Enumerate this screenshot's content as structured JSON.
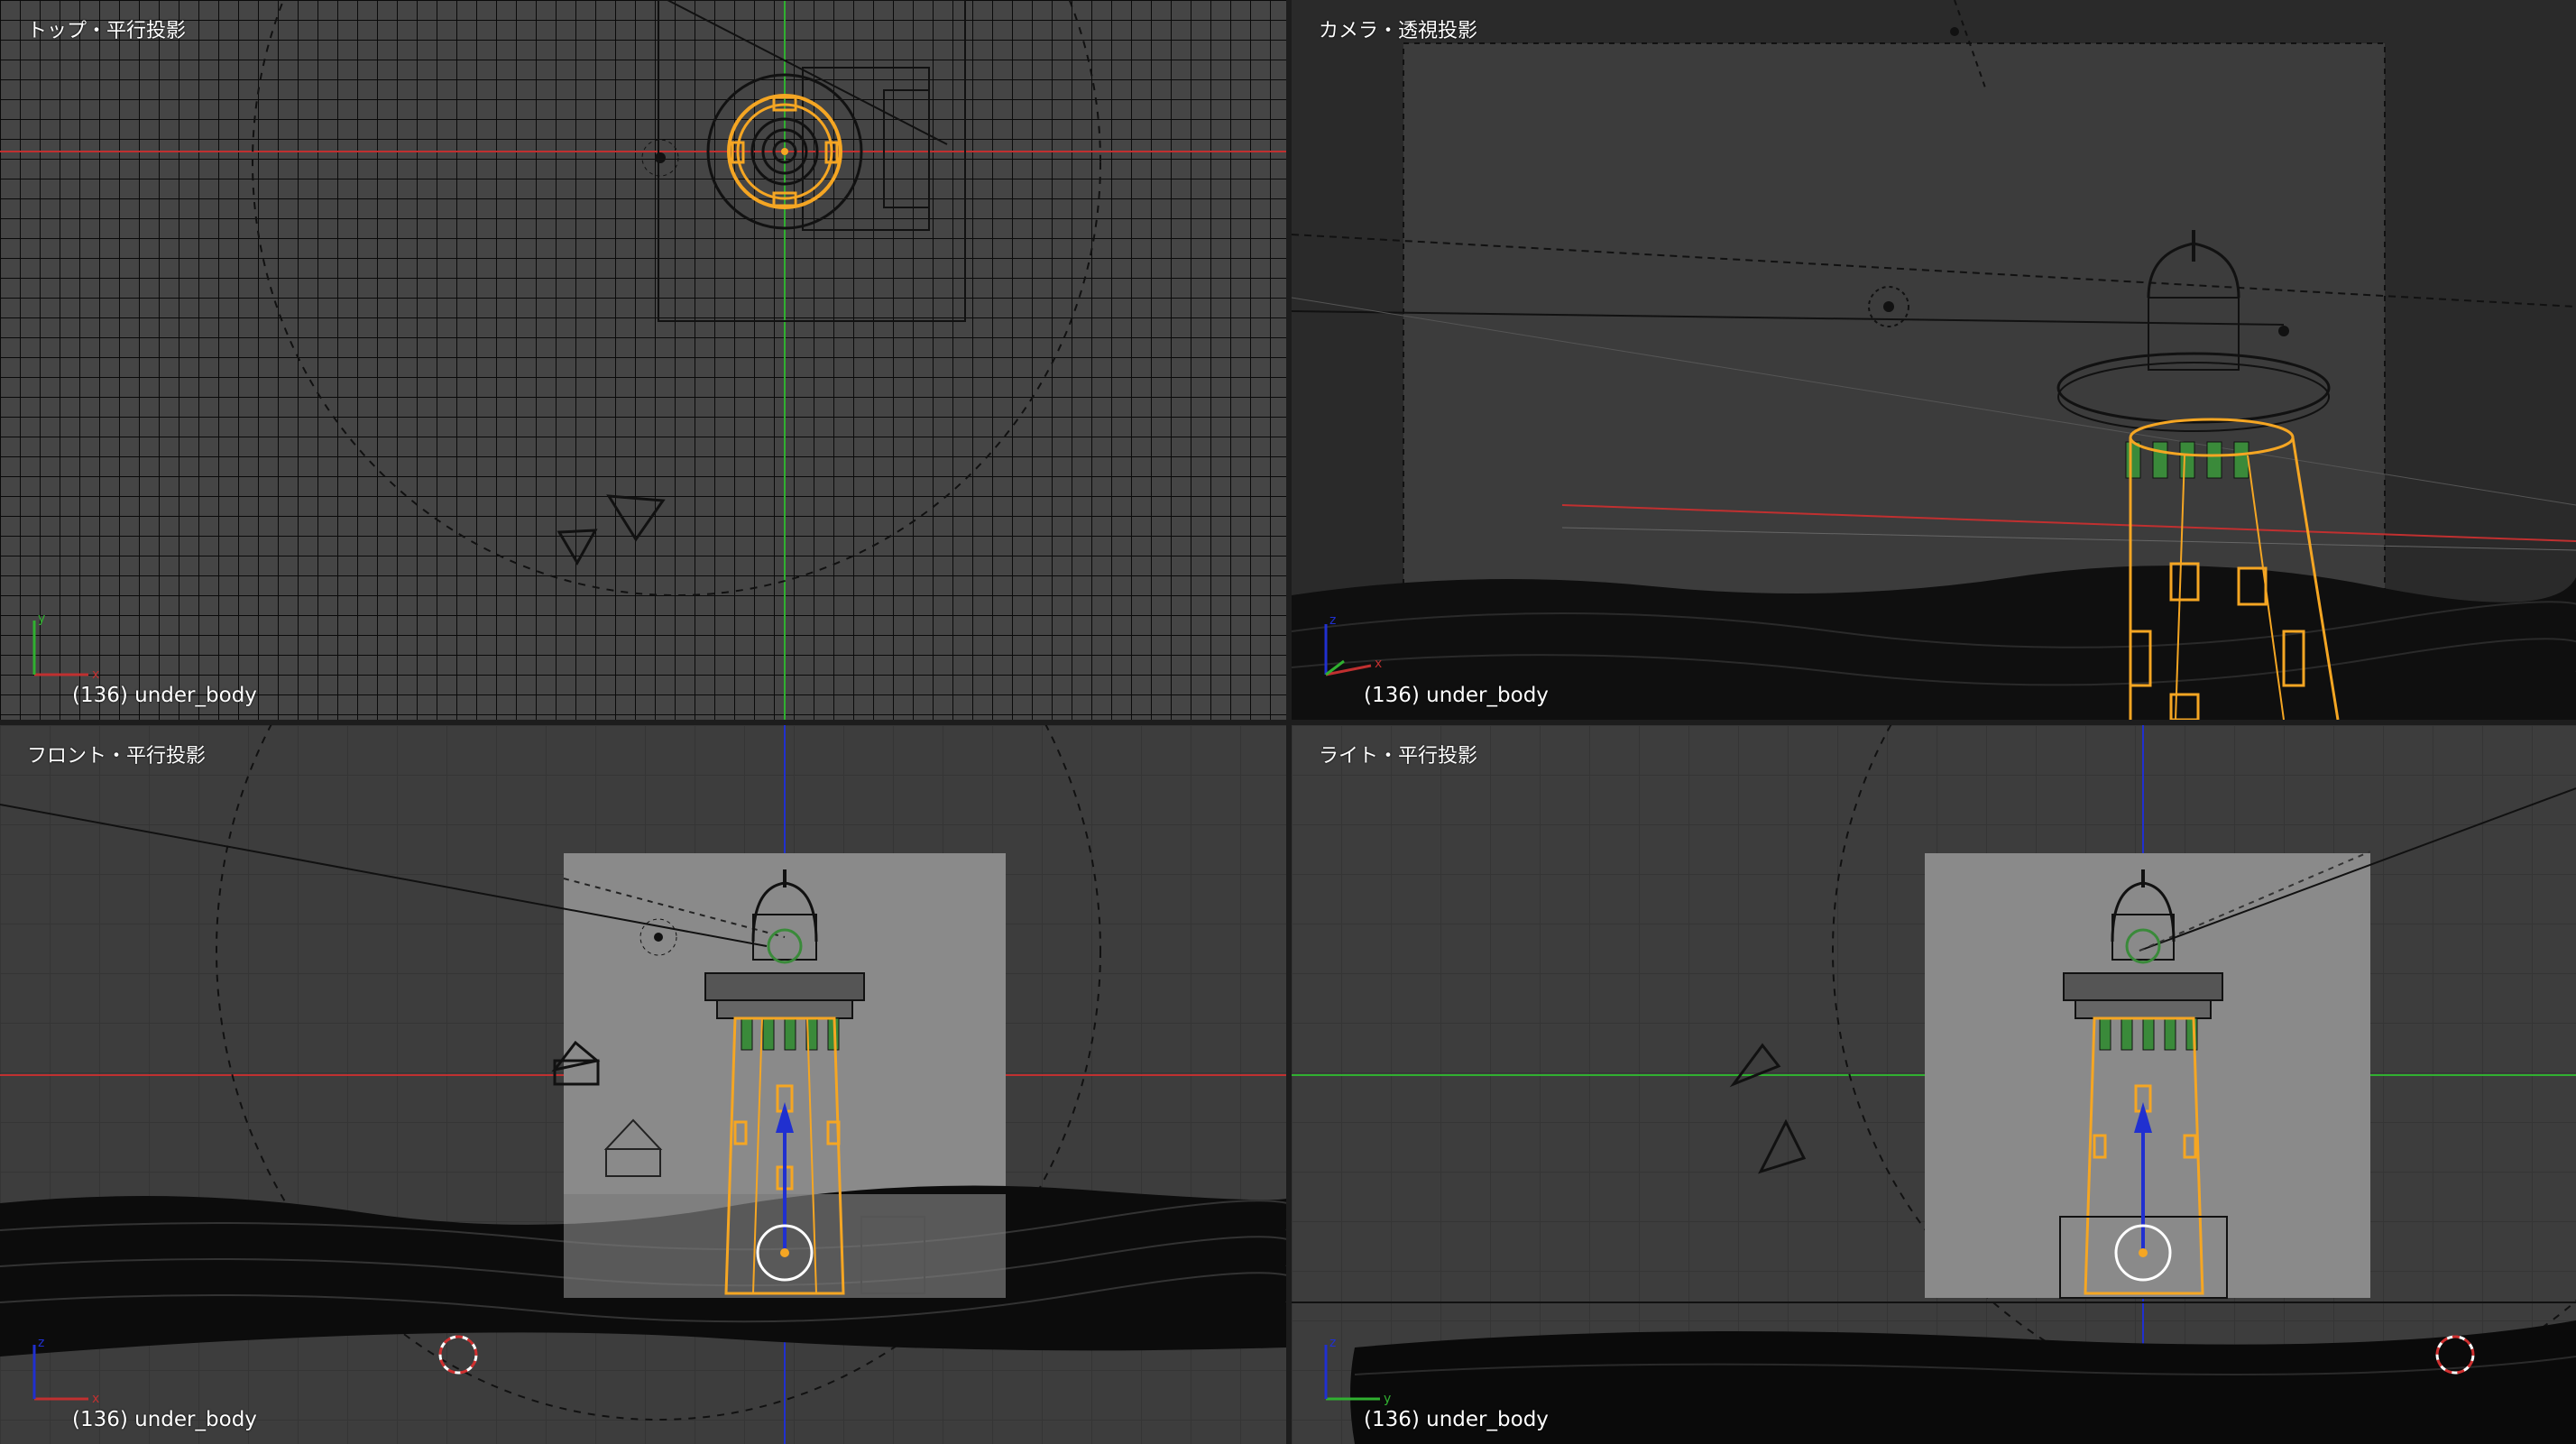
{
  "viewports": {
    "top": {
      "label": "トップ・平行投影",
      "status": "(136) under_body"
    },
    "camera": {
      "label": "カメラ・透視投影",
      "status": "(136) under_body"
    },
    "front": {
      "label": "フロント・平行投影",
      "status": "(136) under_body"
    },
    "right": {
      "label": "ライト・平行投影",
      "status": "(136) under_body"
    }
  },
  "gizmo_axes": {
    "top": [
      "x",
      "y"
    ],
    "camera": [
      "x",
      "z"
    ],
    "front": [
      "x",
      "z"
    ],
    "right": [
      "y",
      "z"
    ]
  },
  "colors": {
    "viewport_bg": "#3d3d3d",
    "selected_wire": "#f5a623",
    "wire": "#000000",
    "axis_x": "#c03030",
    "axis_y": "#30b030",
    "axis_z": "#2030d0",
    "camera_bg": "#8a8a8a",
    "leaf_green": "#3a8a3a"
  }
}
